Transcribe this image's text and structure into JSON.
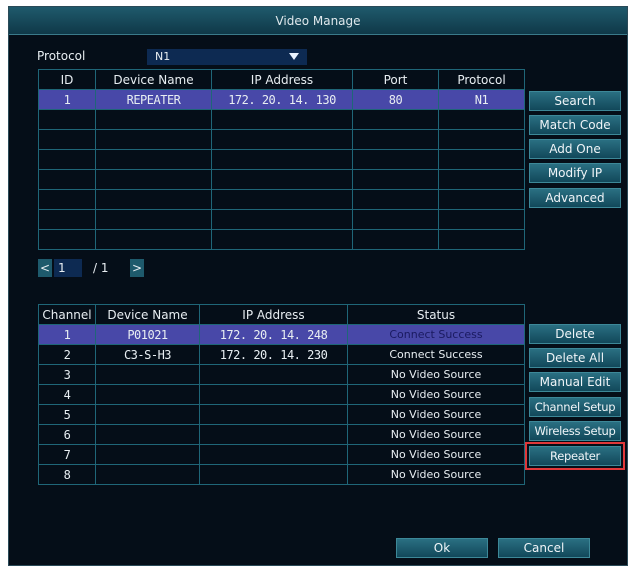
{
  "title": "Video Manage",
  "protocol": {
    "label": "Protocol",
    "value": "N1"
  },
  "search_table": {
    "headers": [
      "ID",
      "Device Name",
      "IP Address",
      "Port",
      "Protocol"
    ],
    "rows": [
      [
        "1",
        "REPEATER",
        "172. 20. 14. 130",
        "80",
        "N1"
      ]
    ],
    "total_rows": 8
  },
  "pagination": {
    "prev": "<",
    "current": "1",
    "separator": "/ 1",
    "next": ">"
  },
  "right_buttons_top": [
    "Search",
    "Match Code",
    "Add One",
    "Modify IP",
    "Advanced"
  ],
  "channel_table": {
    "headers": [
      "Channel",
      "Device Name",
      "IP Address",
      "Status"
    ],
    "rows": [
      [
        "1",
        "P01021",
        "172. 20. 14. 248",
        "Connect Success"
      ],
      [
        "2",
        "C3-S-H3",
        "172. 20. 14. 230",
        "Connect Success"
      ],
      [
        "3",
        "",
        "",
        "No Video Source"
      ],
      [
        "4",
        "",
        "",
        "No Video Source"
      ],
      [
        "5",
        "",
        "",
        "No Video Source"
      ],
      [
        "6",
        "",
        "",
        "No Video Source"
      ],
      [
        "7",
        "",
        "",
        "No Video Source"
      ],
      [
        "8",
        "",
        "",
        "No Video Source"
      ]
    ]
  },
  "right_buttons_bottom": [
    "Delete",
    "Delete All",
    "Manual Edit",
    "Channel Setup",
    "Wireless Setup",
    "Repeater"
  ],
  "ok": "Ok",
  "cancel": "Cancel",
  "colors": {
    "selected_row": "#4848a8",
    "highlight_outline": "#e0383a"
  }
}
